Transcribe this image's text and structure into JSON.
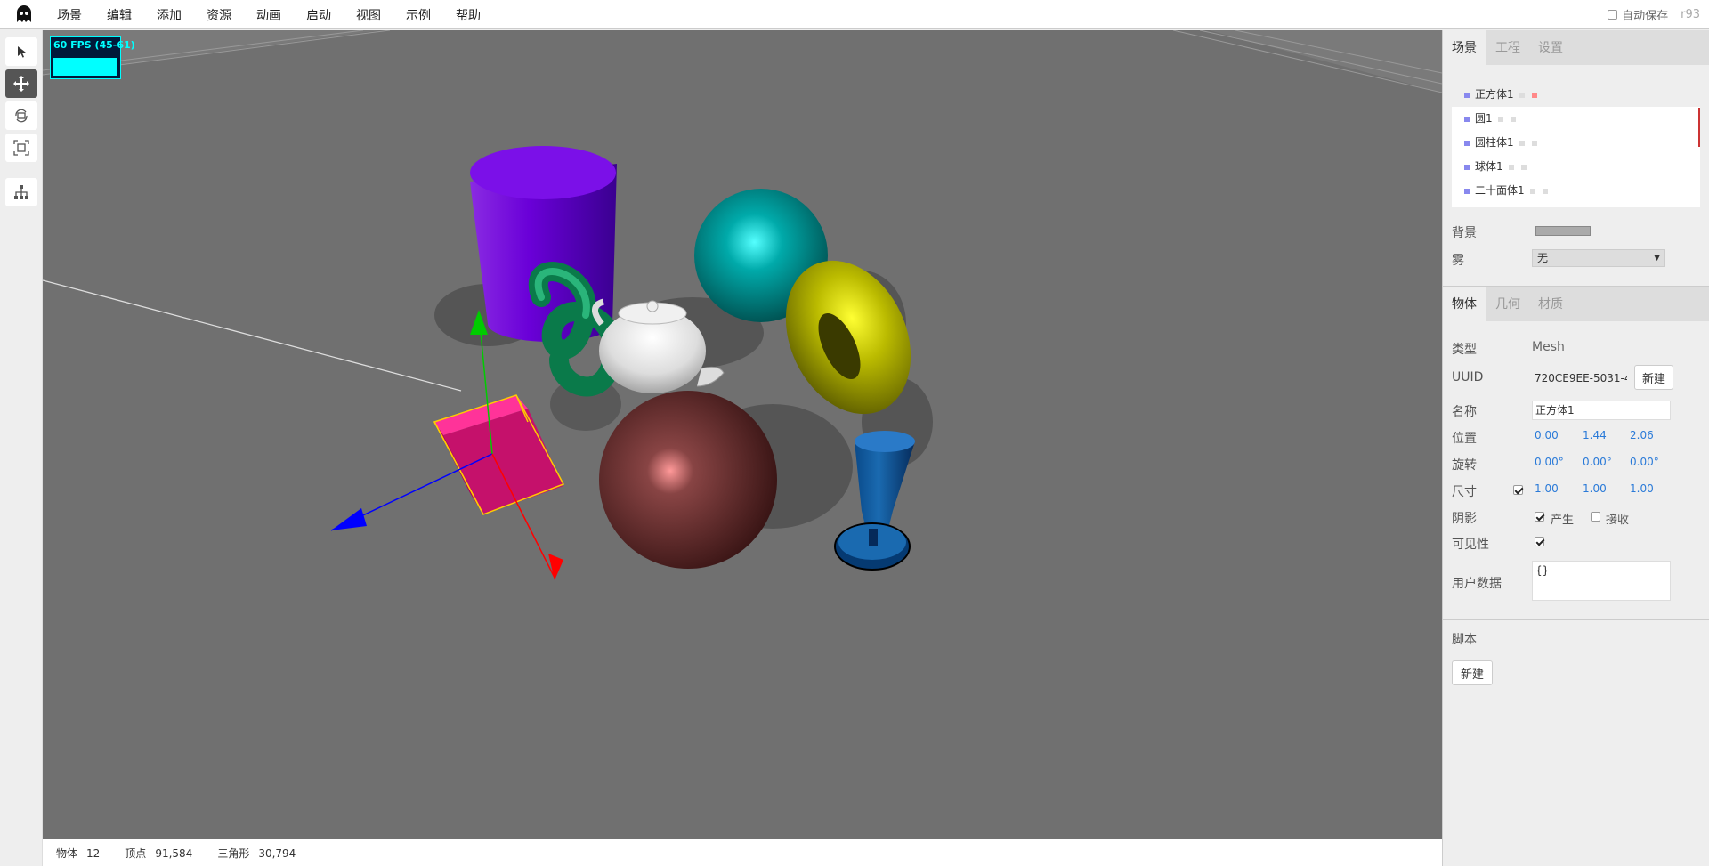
{
  "menubar": {
    "items": [
      "场景",
      "编辑",
      "添加",
      "资源",
      "动画",
      "启动",
      "视图",
      "示例",
      "帮助"
    ],
    "autosave_label": "自动保存",
    "version": "r93"
  },
  "viewport": {
    "fps_text": "60 FPS (45-61)"
  },
  "statusbar": {
    "objects_label": "物体",
    "objects_value": "12",
    "vertices_label": "顶点",
    "vertices_value": "91,584",
    "triangles_label": "三角形",
    "triangles_value": "30,794"
  },
  "sidebar": {
    "top_tabs": [
      "场景",
      "工程",
      "设置"
    ],
    "outliner": [
      {
        "name": "正方体1"
      },
      {
        "name": "圆1"
      },
      {
        "name": "圆柱体1"
      },
      {
        "name": "球体1"
      },
      {
        "name": "二十面体1"
      }
    ],
    "background_label": "背景",
    "fog_label": "雾",
    "fog_value": "无",
    "object_tabs": [
      "物体",
      "几何",
      "材质"
    ],
    "type_label": "类型",
    "type_value": "Mesh",
    "uuid_label": "UUID",
    "uuid_value": "720CE9EE-5031-4",
    "new_label": "新建",
    "name_label": "名称",
    "name_value": "正方体1",
    "position_label": "位置",
    "position": [
      "0.00",
      "1.44",
      "2.06"
    ],
    "rotation_label": "旋转",
    "rotation": [
      "0.00°",
      "0.00°",
      "0.00°"
    ],
    "scale_label": "尺寸",
    "scale": [
      "1.00",
      "1.00",
      "1.00"
    ],
    "shadow_label": "阴影",
    "cast_label": "产生",
    "receive_label": "接收",
    "visible_label": "可见性",
    "userdata_label": "用户数据",
    "userdata_value": "{}",
    "script_label": "脚本",
    "script_new_label": "新建"
  },
  "colors": {
    "background_swatch": "#aaaaaa",
    "accent_number": "#2a7ad8",
    "viewport_bg": "#707070"
  }
}
